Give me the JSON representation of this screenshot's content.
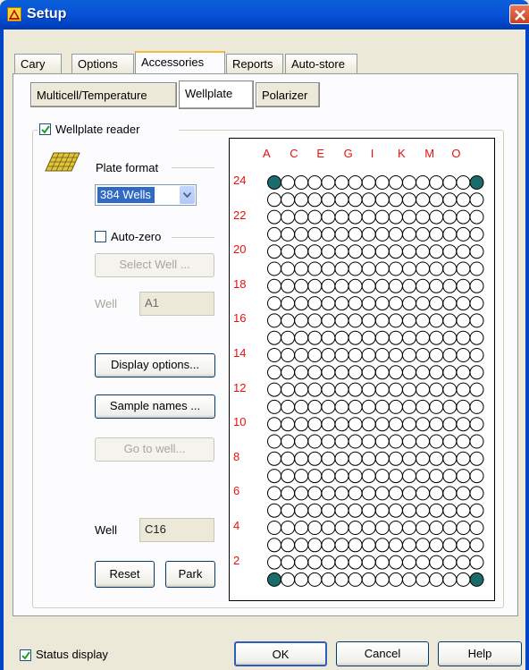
{
  "window": {
    "title": "Setup"
  },
  "tabs": [
    {
      "label": "Cary"
    },
    {
      "label": "Options"
    },
    {
      "label": "Accessories"
    },
    {
      "label": "Reports"
    },
    {
      "label": "Auto-store"
    }
  ],
  "subtabs": [
    {
      "label": "Multicell/Temperature"
    },
    {
      "label": "Wellplate"
    },
    {
      "label": "Polarizer"
    }
  ],
  "wellplate": {
    "reader_label": "Wellplate reader",
    "reader_checked": true,
    "plate_format_label": "Plate format",
    "plate_format_value": "384 Wells",
    "auto_zero_label": "Auto-zero",
    "auto_zero_checked": false,
    "select_well_label": "Select Well ...",
    "well_label": "Well",
    "well_value": "A1",
    "display_options_label": "Display options...",
    "sample_names_label": "Sample names ...",
    "go_to_well_label": "Go to well...",
    "current_well_label": "Well",
    "current_well_value": "C16",
    "reset_label": "Reset",
    "park_label": "Park"
  },
  "plate": {
    "columns": [
      "A",
      "C",
      "E",
      "G",
      "I",
      "K",
      "M",
      "O"
    ],
    "rows": [
      "24",
      "22",
      "20",
      "18",
      "16",
      "14",
      "12",
      "10",
      "8",
      "6",
      "4",
      "2"
    ],
    "grid_cols": 16,
    "grid_rows": 24,
    "highlight_color": "#1a6b6b",
    "label_color": "#e81010"
  },
  "footer": {
    "status_display_label": "Status display",
    "status_display_checked": true,
    "ok_label": "OK",
    "cancel_label": "Cancel",
    "help_label": "Help"
  }
}
